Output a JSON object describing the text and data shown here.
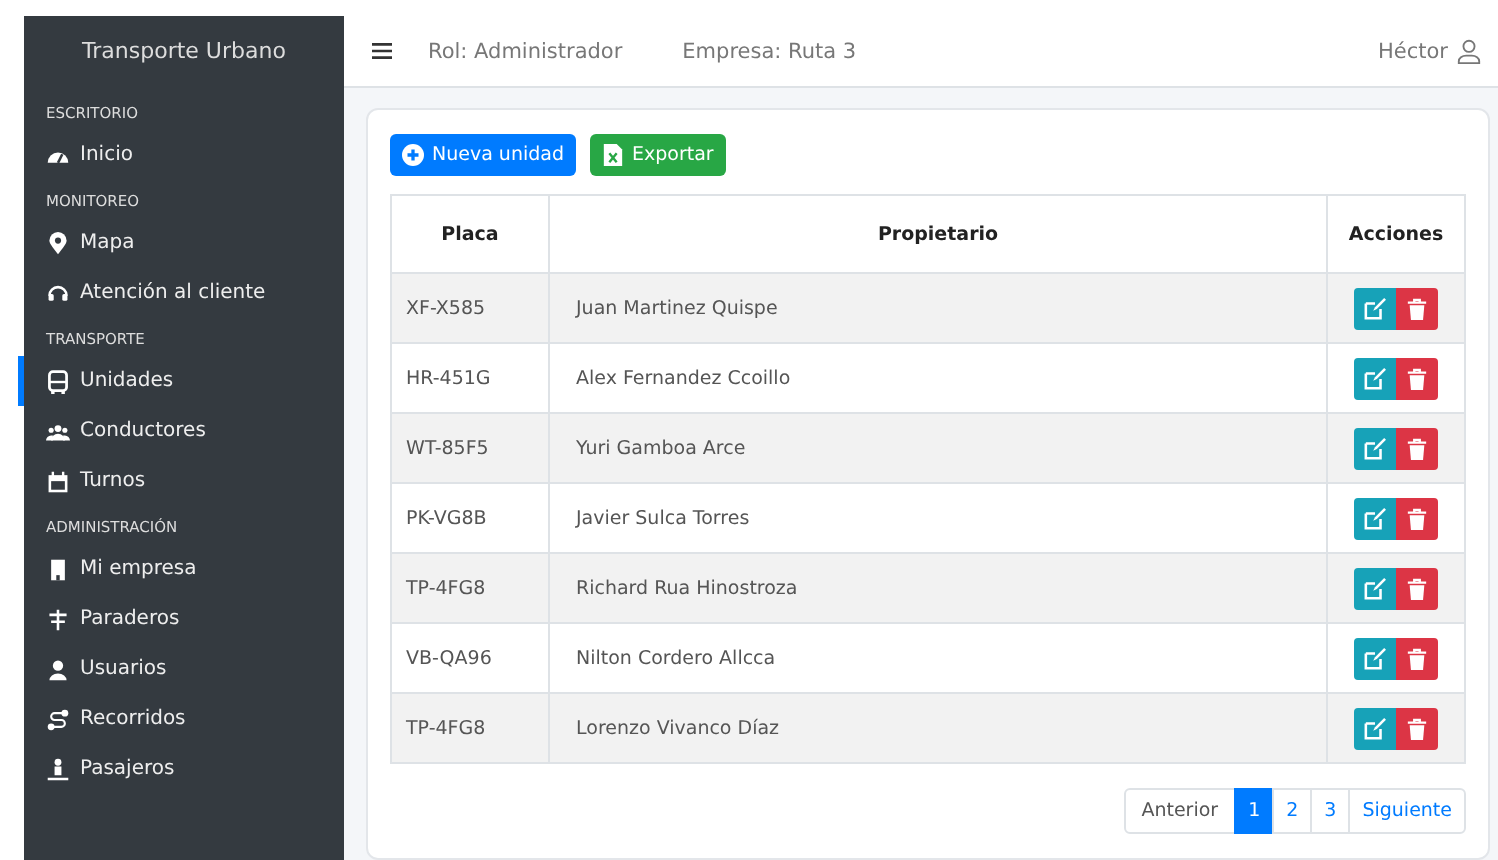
{
  "sidebar": {
    "brand": "Transporte Urbano",
    "sections": [
      {
        "title": "ESCRITORIO",
        "items": [
          {
            "label": "Inicio",
            "selected": false
          }
        ]
      },
      {
        "title": "MONITOREO",
        "items": [
          {
            "label": "Mapa",
            "selected": false
          },
          {
            "label": "Atención al cliente",
            "selected": false
          }
        ]
      },
      {
        "title": "TRANSPORTE",
        "items": [
          {
            "label": "Unidades",
            "selected": true
          },
          {
            "label": "Conductores",
            "selected": false
          },
          {
            "label": "Turnos",
            "selected": false
          }
        ]
      },
      {
        "title": "ADMINISTRACIÓN",
        "items": [
          {
            "label": "Mi empresa",
            "selected": false
          },
          {
            "label": "Paraderos",
            "selected": false
          },
          {
            "label": "Usuarios",
            "selected": false
          },
          {
            "label": "Recorridos",
            "selected": false
          },
          {
            "label": "Pasajeros",
            "selected": false
          }
        ]
      }
    ]
  },
  "topbar": {
    "role": "Rol: Administrador",
    "company": "Empresa: Ruta 3",
    "user": "Héctor"
  },
  "toolbar": {
    "buttons": [
      {
        "label": "Nueva unidad",
        "kind": "primary"
      },
      {
        "label": "Exportar",
        "kind": "export"
      }
    ]
  },
  "table": {
    "columns": [
      "Placa",
      "Propietario",
      "Acciones"
    ],
    "rows": [
      {
        "plate": "XF-X585",
        "owner": "Juan Martinez Quispe"
      },
      {
        "plate": "HR-451G",
        "owner": "Alex Fernandez Ccoillo"
      },
      {
        "plate": "WT-85F5",
        "owner": "Yuri Gamboa Arce"
      },
      {
        "plate": "PK-VG8B",
        "owner": "Javier Sulca Torres"
      },
      {
        "plate": "TP-4FG8",
        "owner": "Richard Rua Hinostroza"
      },
      {
        "plate": "VB-QA96",
        "owner": "Nilton Cordero Allcca"
      },
      {
        "plate": "TP-4FG8",
        "owner": "Lorenzo Vivanco Díaz"
      }
    ]
  },
  "pagination": {
    "previous": "Anterior",
    "pages": [
      {
        "label": "1",
        "selected": true
      },
      {
        "label": "2",
        "selected": false
      },
      {
        "label": "3",
        "selected": false
      }
    ],
    "next": "Siguiente"
  }
}
